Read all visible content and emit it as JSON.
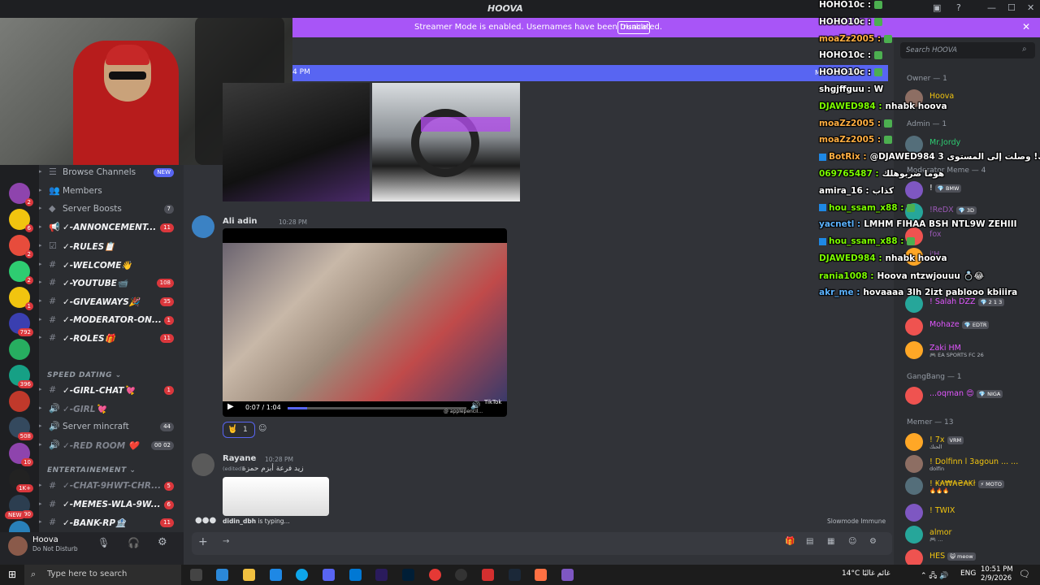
{
  "window": {
    "title": "HOOVA",
    "controls": [
      "—",
      "☐",
      "✕"
    ]
  },
  "banner": {
    "text": "Streamer Mode is enabled. Usernames have been truncated.",
    "button": "Disable",
    "close": "✕"
  },
  "newbar": {
    "left": "4 PM",
    "right": "Mark As Read"
  },
  "search": {
    "placeholder": "Search HOOVA"
  },
  "servers": [
    {
      "badge": "2",
      "color": "#8e44ad"
    },
    {
      "badge": "6",
      "color": "#f1c40f"
    },
    {
      "badge": "2",
      "color": "#e74c3c"
    },
    {
      "badge": "2",
      "color": "#2ecc71"
    },
    {
      "badge": "1",
      "color": "#f1c40f"
    },
    {
      "badge": "792",
      "color": "#3a3fb0"
    },
    {
      "badge": "",
      "color": "#27ae60"
    },
    {
      "badge": "396",
      "color": "#16a085"
    },
    {
      "badge": "",
      "color": "#c0392b"
    },
    {
      "badge": "508",
      "color": "#34495e"
    },
    {
      "badge": "10",
      "color": "#8e44ad"
    },
    {
      "badge": "1K+",
      "color": "#222"
    },
    {
      "badge": "90",
      "color": "#2c3e50"
    },
    {
      "badge": "434",
      "color": "#2980b9"
    }
  ],
  "servers_new": "NEW",
  "channels": [
    {
      "icon": "☰",
      "name": "Browse Channels",
      "plain": true,
      "count": "NEW",
      "countType": "new"
    },
    {
      "icon": "👥",
      "name": "Members",
      "plain": true,
      "count": ""
    },
    {
      "icon": "◆",
      "name": "Server Boosts",
      "plain": true,
      "count": "7",
      "countType": "gray"
    },
    {
      "icon": "📢",
      "name": "✓-ANNONCEMENT...",
      "count": "11"
    },
    {
      "icon": "☑",
      "name": "✓-RULES📋",
      "count": ""
    },
    {
      "icon": "#",
      "name": "✓-WELCOME👋",
      "count": ""
    },
    {
      "icon": "#",
      "name": "✓-YOUTUBE📹",
      "count": "108"
    },
    {
      "icon": "#",
      "name": "✓-GIVEAWAYS🎉",
      "count": "35"
    },
    {
      "icon": "#",
      "name": "✓-MODERATOR-ON...",
      "count": "1"
    },
    {
      "icon": "#",
      "name": "✓-ROLES🎁",
      "count": "11"
    }
  ],
  "cat1": "SPEED DATING ⌄",
  "channels2": [
    {
      "icon": "#",
      "name": "✓-GIRL-CHAT💘",
      "count": "1"
    },
    {
      "icon": "🔊",
      "name": "✓-GIRL💘",
      "count": "",
      "muted": true
    },
    {
      "icon": "🔊",
      "name": "Server mincraft",
      "plain": true,
      "count": "44",
      "countType": "gray"
    },
    {
      "icon": "🔊",
      "name": "✓-RED ROOM ❤️",
      "count": "00  02",
      "countType": "gray",
      "muted": true
    }
  ],
  "cat2": "ENTERTAINEMENT ⌄",
  "channels3": [
    {
      "icon": "#",
      "name": "✓-CHAT-9HWT-CHR...",
      "count": "5",
      "muted": true
    },
    {
      "icon": "#",
      "name": "✓-MEMES-WLA-9W...",
      "count": "6"
    },
    {
      "icon": "#",
      "name": "✓-BANK-RP🏦",
      "count": "11"
    }
  ],
  "user": {
    "name": "Hoova",
    "status": "Do Not Disturb"
  },
  "messages": [
    {
      "name": "Ali adin",
      "time": "10:28 PM",
      "color": "#2ecc71"
    },
    {
      "name": "Rayane",
      "time": "10:28 PM",
      "color": "#2ecc71",
      "edited": "(edited)",
      "text": "زيد فرعة أبزم حمزة"
    }
  ],
  "video": {
    "time": "0:07 / 1:04",
    "progress": 0.11,
    "watermark": "TikTok",
    "credit": "@ applepencil..."
  },
  "reaction": {
    "count": "1"
  },
  "typing": {
    "name": "didin_dbh",
    "suffix": " is typing..."
  },
  "slowmode": "Slowmode Immune",
  "memberlist": {
    "groups": [
      {
        "label": "Owner — 1",
        "members": [
          {
            "name": "Hoova",
            "color": "#f1c40f"
          }
        ]
      },
      {
        "label": "Admin — 1",
        "members": [
          {
            "name": "Mr.Jordy",
            "color": "#2ecc71"
          }
        ]
      },
      {
        "label": "Moderator Meme — 4",
        "members": [
          {
            "name": "!",
            "tag": "💎 BMW",
            "color": "#fff"
          },
          {
            "name": "!ReDX",
            "tag": "💎 3D",
            "color": "#9b59b6"
          },
          {
            "name": "fox",
            "color": "#9b59b6"
          },
          {
            "name": "i'H",
            "color": "#9b59b6"
          }
        ]
      },
      {
        "label": "",
        "members": [
          {
            "name": "! Salah DZZ",
            "tag": "💎 2 1 3",
            "color": "#e056fd"
          },
          {
            "name": "Mohaze",
            "tag": "💎 EDTR",
            "color": "#e056fd"
          },
          {
            "name": "Zaki HM",
            "sub": "🎮 EA SPORTS FC 26",
            "color": "#e056fd"
          }
        ]
      },
      {
        "label": "GangBang — 1",
        "members": [
          {
            "name": "...oqman 😍",
            "tag": "💎 NIGA",
            "color": "#e056fd"
          }
        ]
      },
      {
        "label": "Memer — 13",
        "members": [
          {
            "name": "! 7x",
            "tag": "VRM",
            "sub": "الحنك",
            "color": "#f1c40f"
          },
          {
            "name": "! Dolfinn l 3agoun ... ...",
            "sub": "dolfin",
            "color": "#f1c40f"
          },
          {
            "name": "! ₭₳₩₳₴₳₭ł",
            "tag": "⚡ MOTO",
            "sub": "🔥🔥🔥",
            "color": "#f1c40f"
          },
          {
            "name": "! TWIX",
            "color": "#f1c40f"
          },
          {
            "name": "almor",
            "sub": "🎮 ...",
            "color": "#f1c40f"
          },
          {
            "name": "HES",
            "tag": "😺 meow",
            "color": "#f1c40f"
          }
        ]
      }
    ]
  },
  "overlay": [
    {
      "user": "HOHO10c :",
      "cls": "",
      "text": "",
      "em": true
    },
    {
      "user": "HOHO10c :",
      "cls": "",
      "text": "",
      "em": true
    },
    {
      "user": "moaZz2005 :",
      "cls": "o",
      "text": "",
      "em": true
    },
    {
      "user": "HOHO10c :",
      "cls": "",
      "text": "",
      "em": true
    },
    {
      "user": "HOHO10c :",
      "cls": "",
      "text": "",
      "em": true
    },
    {
      "user": "shgjffguu :",
      "cls": "",
      "text": "W",
      "em": false
    },
    {
      "user": "DJAWED984 :",
      "cls": "g",
      "text": "nhabk hoova",
      "em": false
    },
    {
      "user": "moaZz2005 :",
      "cls": "o",
      "text": "",
      "em": true
    },
    {
      "user": "moaZz2005 :",
      "cls": "o",
      "text": "",
      "em": true
    },
    {
      "user": "BotRix :",
      "cls": "o",
      "text": "@DJAWED984 مبروك! وصلت إلى المستوى 3",
      "em": false,
      "bot": true
    },
    {
      "user": "069765487 :",
      "cls": "g",
      "text": "هوما ضربوهلك",
      "em": false
    },
    {
      "user": "amira_16 :",
      "cls": "",
      "text": "كذاب",
      "em": false
    },
    {
      "user": "hou_ssam_x88 :",
      "cls": "g",
      "text": "",
      "em": true,
      "bot": true
    },
    {
      "user": "yacnetl :",
      "cls": "b",
      "text": "LMHM FIHAA BSH NTL9W ZEHIII",
      "em": false
    },
    {
      "user": "hou_ssam_x88 :",
      "cls": "g",
      "text": "",
      "em": true,
      "bot": true
    },
    {
      "user": "DJAWED984 :",
      "cls": "g",
      "text": "nhabk hoova",
      "em": false
    },
    {
      "user": "rania1008 :",
      "cls": "g",
      "text": "Hoova ntzwjouuu 💍😂",
      "em": false
    },
    {
      "user": "akr_me :",
      "cls": "b",
      "text": "hovaaaa 3lh 2izt pablooo kbiiira",
      "em": false
    }
  ],
  "taskbar": {
    "search": "Type here to search",
    "weather": "14°C  غائم غالبًا",
    "lang": "ENG",
    "time": "10:51 PM",
    "date": "2/9/2026"
  }
}
